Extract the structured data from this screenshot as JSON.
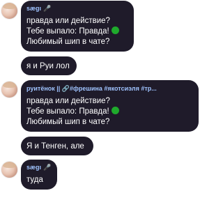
{
  "messages": [
    {
      "author": "sægı",
      "badge": "🎤",
      "lines": [
        "правда или действие?",
        "Тебе выпало: Правда!",
        "Любимый шип в чате?"
      ]
    },
    {
      "text": "я и Руи лол"
    },
    {
      "author": "руитёнок || 🔗#фрешина #якотсиэля #тр...",
      "lines": [
        "правда или действие?",
        "Тебе выпало: Правда!",
        "Любимый шип в чате?"
      ]
    },
    {
      "text": "Я и Тенген, але"
    },
    {
      "author": "sægı",
      "badge": "🎤",
      "lines": [
        "туда"
      ]
    }
  ],
  "colors": {
    "bubble": "#1f1b2a",
    "name": "#9fc3ff",
    "status_dot": "#1faa2c"
  },
  "icons": [
    "avatar",
    "green-circle-icon",
    "mic-icon"
  ]
}
